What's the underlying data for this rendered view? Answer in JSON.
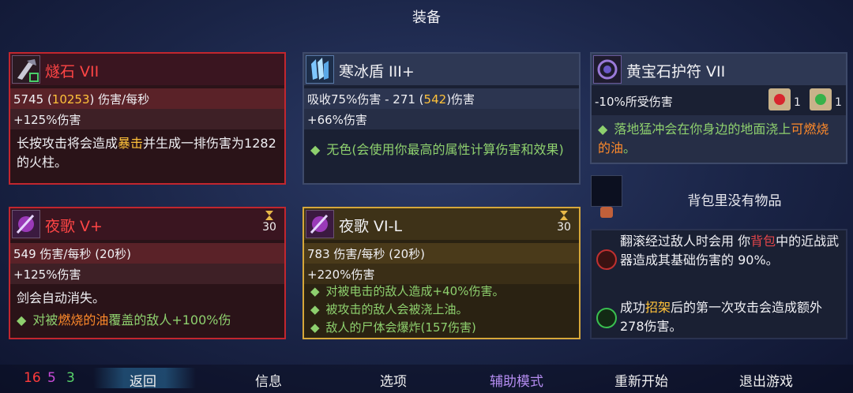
{
  "title": "装备",
  "cards": {
    "flint": {
      "name": "燧石 VII",
      "stat_dps_base": "5745 (",
      "stat_dps_value": "10253",
      "stat_dps_suffix": ") 伤害/每秒",
      "stat_dmg": "+125%伤害",
      "desc_a": "长按攻击将会造成",
      "desc_crit": "暴击",
      "desc_b": "并生成一排伤害为1282的火柱。"
    },
    "shield": {
      "name": "寒冰盾 III+",
      "stat_a": "吸收75%伤害 - 271 (",
      "stat_value": "542",
      "stat_b": ")伤害",
      "stat_dmg": "+66%伤害",
      "desc": "无色(会使用你最高的属性计算伤害和效果)",
      "bullet": "◆"
    },
    "amulet": {
      "name": "黄宝石护符 VII",
      "stat": "-10%所受伤害",
      "scroll1_count": "1",
      "scroll2_count": "1",
      "desc_a": "落地猛冲会在你身边的地面浇上",
      "desc_oil": "可燃烧的油",
      "desc_b": "。",
      "bullet": "◆"
    },
    "backpack": {
      "empty_text": "背包里没有物品"
    },
    "nocturne1": {
      "name": "夜歌 V+",
      "timer": "30",
      "stat_dps": "549 伤害/每秒 (20秒)",
      "stat_dmg": "+125%伤害",
      "desc": "剑会自动消失。",
      "bullet_a": "对被",
      "bullet_burn": "燃烧的油",
      "bullet_b": "覆盖的敌人+100%伤",
      "bullet": "◆"
    },
    "nocturne2": {
      "name": "夜歌 VI-L",
      "timer": "30",
      "stat_dps": "783 伤害/每秒 (20秒)",
      "stat_dmg": "+220%伤害",
      "line1": "对被电击的敌人造成+40%伤害。",
      "line2": "被攻击的敌人会被浇上油。",
      "line3": "敌人的尸体会爆炸(157伤害)",
      "bullet": "◆"
    },
    "mutations": {
      "m1_a": "翻滚经过敌人时会用 你",
      "m1_bag": "背包",
      "m1_b": "中的近战武器造成其基础伤害的 90%。",
      "m2_a": "成功",
      "m2_parry": "招架",
      "m2_b": "后的第一次攻击会造成额外278伤害。"
    }
  },
  "stats": {
    "brutality": "16",
    "tactics": "5",
    "survival": "3"
  },
  "menu": {
    "back": "返回",
    "info": "信息",
    "options": "选项",
    "assist": "辅助模式",
    "restart": "重新开始",
    "quit": "退出游戏"
  },
  "colors": {
    "brutality": "#ff3b3b",
    "tactics": "#c94bd9",
    "survival": "#58d36a",
    "assist": "#b48cf0"
  }
}
